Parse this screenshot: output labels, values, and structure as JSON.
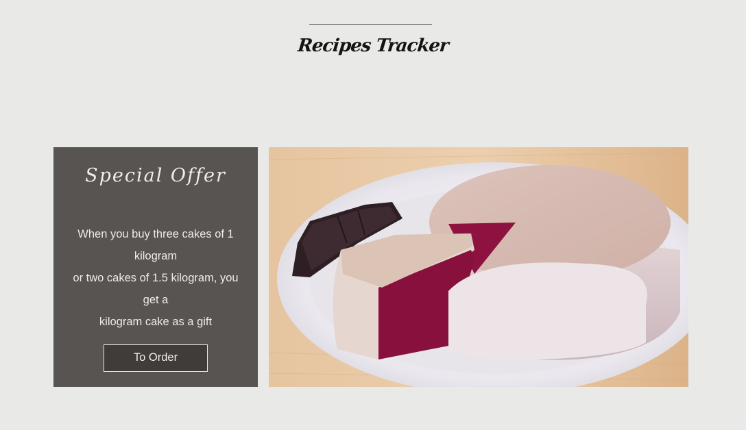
{
  "header": {
    "title": "Recipes Tracker"
  },
  "offer": {
    "title": "Special Offer",
    "lines": [
      "When you buy three cakes of 1",
      "kilogram",
      "or two cakes of 1.5 kilogram, you",
      "get a",
      "kilogram cake as a gift"
    ],
    "button_label": "To Order"
  },
  "image": {
    "subject": "red-velvet-cake-photo"
  },
  "colors": {
    "page_background": "#e9eae8",
    "card_background": "#575451",
    "button_background": "#3f3c3a",
    "cake_crumb": "#8e1240"
  }
}
